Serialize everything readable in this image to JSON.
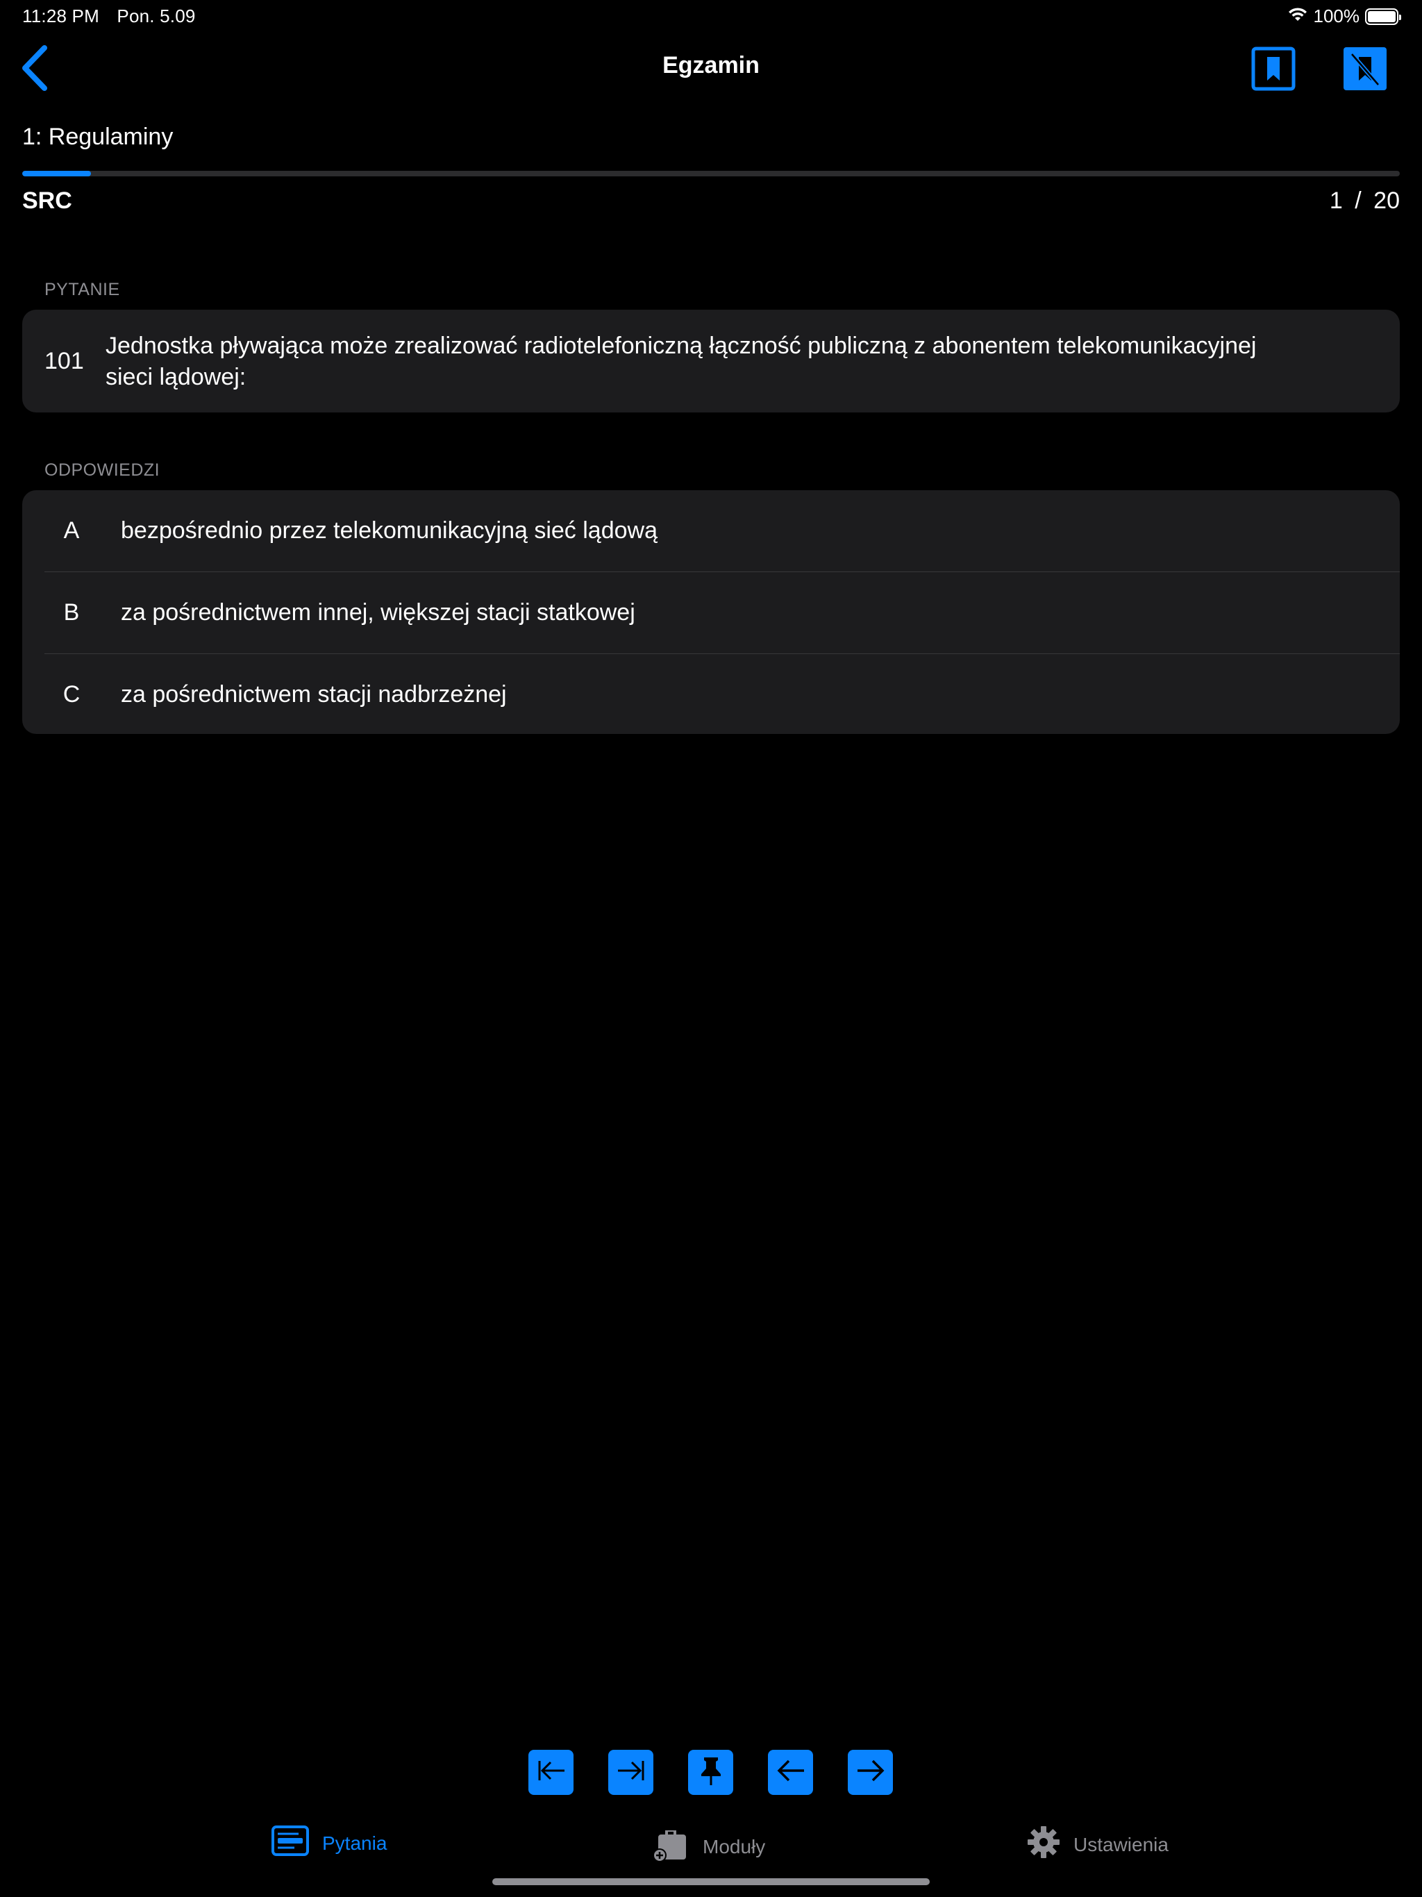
{
  "status_bar": {
    "time": "11:28 PM",
    "date": "Pon. 5.09",
    "battery": "100%"
  },
  "nav": {
    "title": "Egzamin",
    "back_icon": "chevron-left-icon",
    "bookmark_icon": "bookmark-icon",
    "bookmark_remove_icon": "bookmark-slash-icon"
  },
  "module": {
    "title": "1:  Regulaminy",
    "tag": "SRC",
    "current": "1",
    "separator": "/",
    "total": "20",
    "progress": 0.05
  },
  "question": {
    "header": "PYTANIE",
    "number": "101",
    "text": "Jednostka pływająca może zrealizować radiotelefoniczną łączność publiczną z abonentem telekomunikacyjnej sieci lądowej:"
  },
  "answers": {
    "header": "ODPOWIEDZI",
    "items": [
      {
        "letter": "A",
        "text": "bezpośrednio przez telekomunikacyjną sieć lądową"
      },
      {
        "letter": "B",
        "text": "za pośrednictwem innej, większej stacji statkowej"
      },
      {
        "letter": "C",
        "text": "za pośrednictwem stacji nadbrzeżnej"
      }
    ]
  },
  "toolbar": {
    "buttons": [
      "first-question-icon",
      "last-question-icon",
      "pin-icon",
      "previous-arrow-icon",
      "next-arrow-icon"
    ]
  },
  "tabbar": {
    "tabs": [
      {
        "label": "Pytania",
        "icon": "questions-icon",
        "active": true
      },
      {
        "label": "Moduły",
        "icon": "modules-icon",
        "active": false
      },
      {
        "label": "Ustawienia",
        "icon": "settings-gear-icon",
        "active": false
      }
    ]
  },
  "colors": {
    "accent": "#0a84ff",
    "card": "#1c1c1e",
    "background": "#000000",
    "secondary_text": "#8e8e93"
  }
}
